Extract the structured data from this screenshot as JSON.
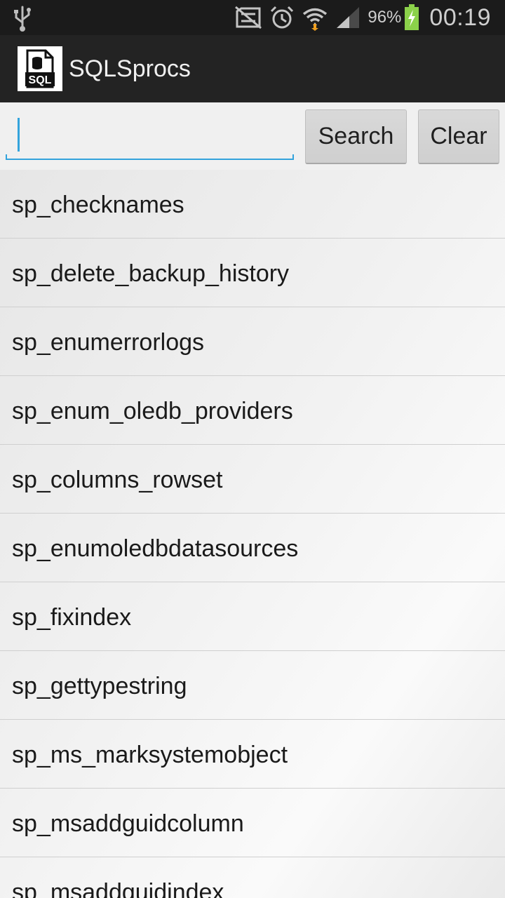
{
  "status_bar": {
    "battery_percent": "96%",
    "time": "00:19",
    "icons": [
      "usb-icon",
      "no-sim-icon",
      "alarm-icon",
      "wifi-icon",
      "signal-icon",
      "battery-charging-icon"
    ],
    "battery_color": "#8bd14a"
  },
  "action_bar": {
    "app_icon_text": "SQL",
    "title": "SQLSprocs"
  },
  "search": {
    "value": "",
    "placeholder": "",
    "search_label": "Search",
    "clear_label": "Clear",
    "accent_color": "#33a3dc"
  },
  "procedures": [
    "sp_checknames",
    "sp_delete_backup_history",
    "sp_enumerrorlogs",
    "sp_enum_oledb_providers",
    "sp_columns_rowset",
    "sp_enumoledbdatasources",
    "sp_fixindex",
    "sp_gettypestring",
    "sp_ms_marksystemobject",
    "sp_msaddguidcolumn",
    "sp_msaddguidindex"
  ]
}
